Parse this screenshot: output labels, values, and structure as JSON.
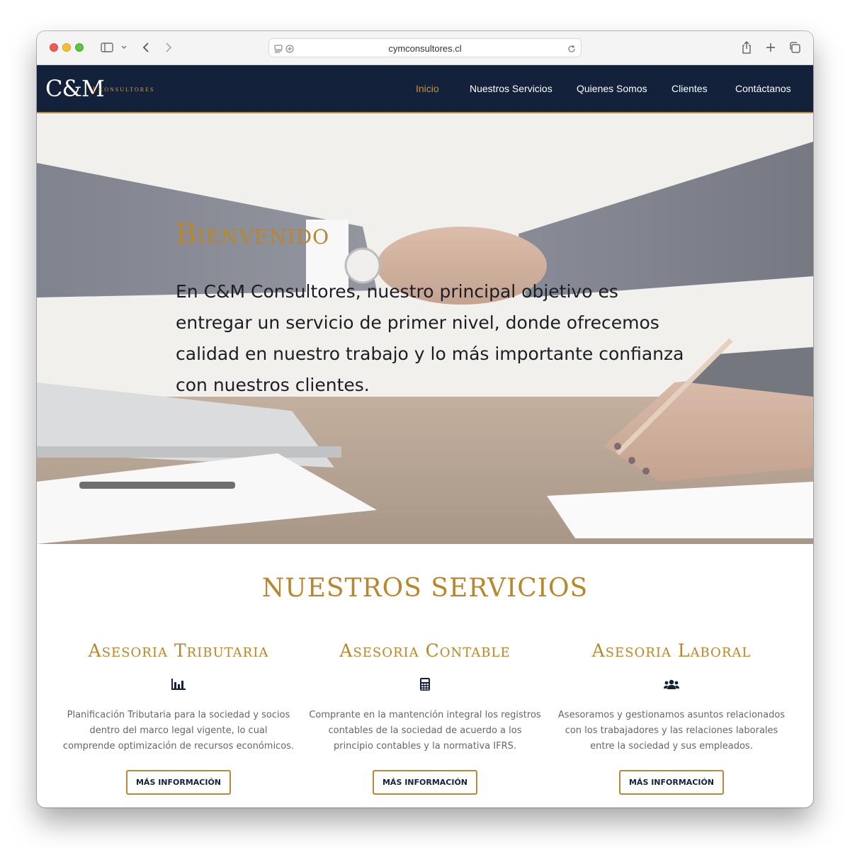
{
  "browser": {
    "url": "cymconsultores.cl"
  },
  "brand": {
    "logo_mark": "C&M",
    "logo_sub": "CONSULTORES",
    "gold": "#b58a3a",
    "navy": "#14213a"
  },
  "nav": {
    "items": [
      {
        "label": "Inicio",
        "active": true
      },
      {
        "label": "Nuestros Servicios",
        "active": false
      },
      {
        "label": "Quienes Somos",
        "active": false
      },
      {
        "label": "Clientes",
        "active": false
      },
      {
        "label": "Contáctanos",
        "active": false
      }
    ]
  },
  "hero": {
    "title": "Bienvenido",
    "text": "En C&M Consultores, nuestro principal objetivo es entregar un servicio de primer nivel, donde ofrecemos calidad en nuestro trabajo y lo más importante confianza con nuestros clientes."
  },
  "services": {
    "title": "NUESTROS SERVICIOS",
    "items": [
      {
        "title": "Asesoria Tributaria",
        "icon": "bar-chart-icon",
        "desc": "Planificación Tributaria para la sociedad y socios dentro del marco legal vigente, lo cual comprende optimización de recursos económicos.",
        "button": "MÁS INFORMACIÓN"
      },
      {
        "title": "Asesoria Contable",
        "icon": "calculator-icon",
        "desc": "Comprante en la mantención integral los registros contables de la sociedad de acuerdo a los principio contables y la normativa IFRS.",
        "button": "MÁS INFORMACIÓN"
      },
      {
        "title": "Asesoria Laboral",
        "icon": "users-icon",
        "desc": "Asesoramos y gestionamos asuntos relacionados con los trabajadores y las relaciones laborales entre la sociedad y sus empleados.",
        "button": "MÁS INFORMACIÓN"
      }
    ]
  }
}
